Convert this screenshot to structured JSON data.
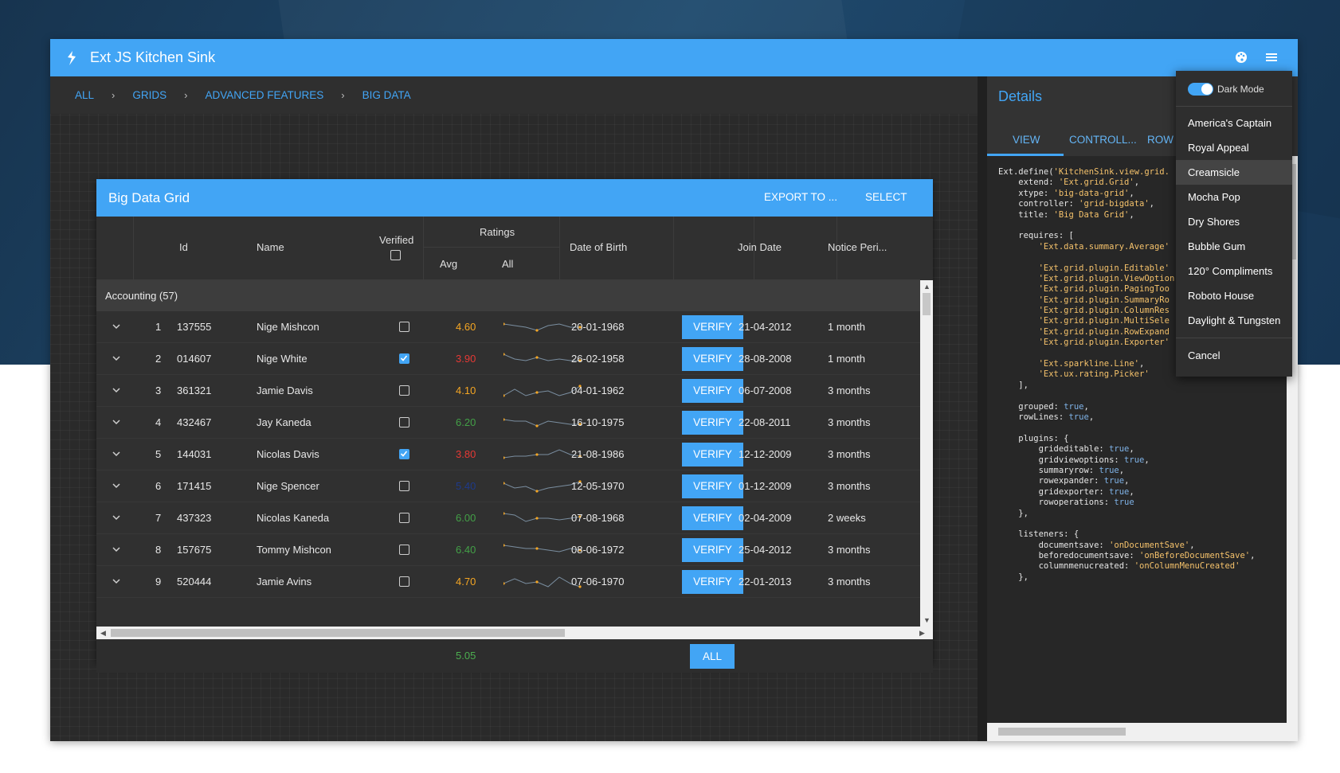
{
  "app": {
    "title": "Ext JS Kitchen Sink"
  },
  "breadcrumb": [
    "ALL",
    "GRIDS",
    "ADVANCED FEATURES",
    "BIG DATA"
  ],
  "grid": {
    "title": "Big Data Grid",
    "export_label": "EXPORT TO ...",
    "select_label": "SELECT",
    "columns": {
      "id": "Id",
      "name": "Name",
      "verified": "Verified",
      "ratings": "Ratings",
      "avg": "Avg",
      "all": "All",
      "dob": "Date of Birth",
      "join": "Join Date",
      "notice": "Notice Peri..."
    },
    "group_label": "Accounting (57)",
    "verify_label": "VERIFY",
    "rows": [
      {
        "num": "1",
        "id": "137555",
        "name": "Nige Mishcon",
        "verified": false,
        "avg": "4.60",
        "avg_color": "#f5a623",
        "dob": "20-01-1968",
        "join": "21-04-2012",
        "notice": "1 month"
      },
      {
        "num": "2",
        "id": "014607",
        "name": "Nige White",
        "verified": true,
        "avg": "3.90",
        "avg_color": "#e53935",
        "dob": "26-02-1958",
        "join": "28-08-2008",
        "notice": "1 month"
      },
      {
        "num": "3",
        "id": "361321",
        "name": "Jamie Davis",
        "verified": false,
        "avg": "4.10",
        "avg_color": "#f5a623",
        "dob": "04-01-1962",
        "join": "06-07-2008",
        "notice": "3 months"
      },
      {
        "num": "4",
        "id": "432467",
        "name": "Jay Kaneda",
        "verified": false,
        "avg": "6.20",
        "avg_color": "#43a047",
        "dob": "16-10-1975",
        "join": "22-08-2011",
        "notice": "3 months"
      },
      {
        "num": "5",
        "id": "144031",
        "name": "Nicolas Davis",
        "verified": true,
        "avg": "3.80",
        "avg_color": "#e53935",
        "dob": "21-08-1986",
        "join": "12-12-2009",
        "notice": "3 months"
      },
      {
        "num": "6",
        "id": "171415",
        "name": "Nige Spencer",
        "verified": false,
        "avg": "5.40",
        "avg_color": "#1e3a8a",
        "dob": "12-05-1970",
        "join": "01-12-2009",
        "notice": "3 months"
      },
      {
        "num": "7",
        "id": "437323",
        "name": "Nicolas Kaneda",
        "verified": false,
        "avg": "6.00",
        "avg_color": "#43a047",
        "dob": "07-08-1968",
        "join": "02-04-2009",
        "notice": "2 weeks"
      },
      {
        "num": "8",
        "id": "157675",
        "name": "Tommy Mishcon",
        "verified": false,
        "avg": "6.40",
        "avg_color": "#43a047",
        "dob": "08-06-1972",
        "join": "25-04-2012",
        "notice": "3 months"
      },
      {
        "num": "9",
        "id": "520444",
        "name": "Jamie Avins",
        "verified": false,
        "avg": "4.70",
        "avg_color": "#f5a623",
        "dob": "07-06-1970",
        "join": "22-01-2013",
        "notice": "3 months"
      }
    ],
    "summary_avg": "5.05",
    "all_label": "ALL"
  },
  "details": {
    "title": "Details",
    "tabs": [
      "VIEW",
      "CONTROLL...",
      "ROW"
    ],
    "code_lines": [
      "Ext.define('KitchenSink.view.grid.",
      "    extend: 'Ext.grid.Grid',",
      "    xtype: 'big-data-grid',",
      "    controller: 'grid-bigdata',",
      "    title: 'Big Data Grid',",
      "",
      "    requires: [",
      "        'Ext.data.summary.Average'",
      "",
      "        'Ext.grid.plugin.Editable'",
      "        'Ext.grid.plugin.ViewOption",
      "        'Ext.grid.plugin.PagingToo",
      "        'Ext.grid.plugin.SummaryRo",
      "        'Ext.grid.plugin.ColumnRes",
      "        'Ext.grid.plugin.MultiSele",
      "        'Ext.grid.plugin.RowExpand",
      "        'Ext.grid.plugin.Exporter'",
      "",
      "        'Ext.sparkline.Line',",
      "        'Ext.ux.rating.Picker'",
      "    ],",
      "",
      "    grouped: true,",
      "    rowLines: true,",
      "",
      "    plugins: {",
      "        grideditable: true,",
      "        gridviewoptions: true,",
      "        summaryrow: true,",
      "        rowexpander: true,",
      "        gridexporter: true,",
      "        rowoperations: true",
      "    },",
      "",
      "    listeners: {",
      "        documentsave: 'onDocumentSave',",
      "        beforedocumentsave: 'onBeforeDocumentSave',",
      "        columnmenucreated: 'onColumnMenuCreated'",
      "    },"
    ]
  },
  "menu": {
    "dark_mode_label": "Dark Mode",
    "dark_mode_on": true,
    "items": [
      "America's Captain",
      "Royal Appeal",
      "Creamsicle",
      "Mocha Pop",
      "Dry Shores",
      "Bubble Gum",
      "120° Compliments",
      "Roboto House",
      "Daylight & Tungsten"
    ],
    "highlighted": "Creamsicle",
    "cancel_label": "Cancel"
  },
  "colors": {
    "accent": "#42a5f5",
    "panel_dark": "#2a2a2a",
    "sparkline": "#f5a623"
  }
}
